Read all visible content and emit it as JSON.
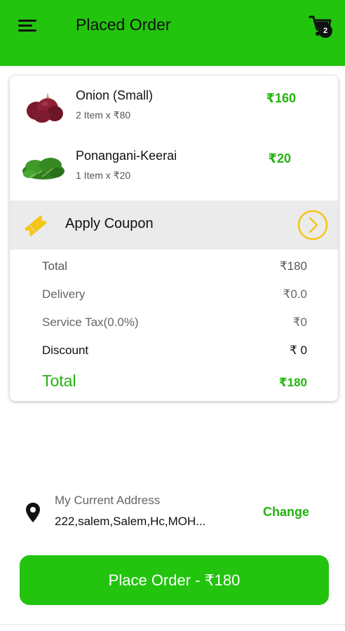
{
  "header": {
    "title": "Placed Order",
    "cart_count": "2"
  },
  "items": [
    {
      "name": "Onion (Small)",
      "qty": "2 Item x ₹80",
      "price": "₹160",
      "image": "onion-image"
    },
    {
      "name": "Ponangani-Keerai",
      "qty": "1 Item x ₹20",
      "price": "₹20",
      "image": "greens-image"
    }
  ],
  "coupon": {
    "label": "Apply Coupon"
  },
  "summary": {
    "total_label": "Total",
    "total_value": "₹180",
    "delivery_label": "Delivery",
    "delivery_value": "₹0.0",
    "tax_label": "Service Tax(0.0%)",
    "tax_value": "₹0",
    "discount_label": "Discount",
    "discount_value": "₹ 0",
    "grand_label": "Total",
    "grand_value": "₹180"
  },
  "address": {
    "label": "My Current Address",
    "value": "222,salem,Salem,Hc,MOH...",
    "change_label": "Change"
  },
  "place_order": {
    "label": "Place Order - ₹180"
  },
  "colors": {
    "brand_green": "#22c40e",
    "price_green": "#22b40e",
    "coupon_yellow": "#f5c518"
  },
  "icons": [
    "menu-icon",
    "cart-icon",
    "coupon-ticket-icon",
    "chevron-right-icon",
    "location-pin-icon"
  ]
}
